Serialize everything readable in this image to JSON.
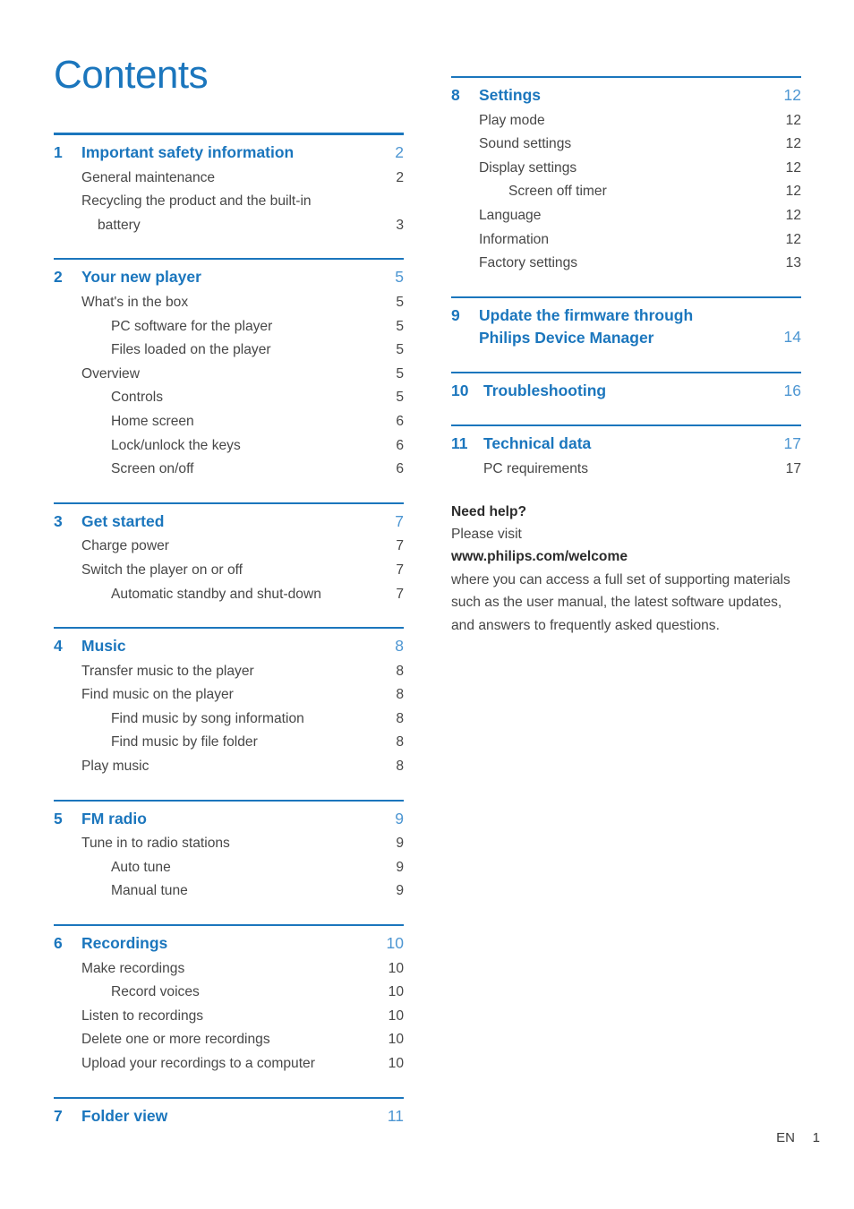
{
  "document": {
    "title": "Contents",
    "accent_color": "#1b76bd",
    "text_color": "#474747"
  },
  "left_column": {
    "chapters": [
      {
        "number": "1",
        "title": "Important safety information",
        "page": "2",
        "rule": "thick",
        "entries": [
          {
            "label": "General maintenance",
            "page": "2",
            "level": 1
          },
          {
            "label": "Recycling the product and the built-in",
            "page": "",
            "level": 1
          },
          {
            "label": "battery",
            "page": "3",
            "level": "1c"
          }
        ]
      },
      {
        "number": "2",
        "title": "Your new player",
        "page": "5",
        "rule": "thin",
        "entries": [
          {
            "label": "What's in the box",
            "page": "5",
            "level": 1
          },
          {
            "label": "PC software for the player",
            "page": "5",
            "level": 2
          },
          {
            "label": "Files loaded on the player",
            "page": "5",
            "level": 2
          },
          {
            "label": "Overview",
            "page": "5",
            "level": 1
          },
          {
            "label": "Controls",
            "page": "5",
            "level": 2
          },
          {
            "label": "Home screen",
            "page": "6",
            "level": 2
          },
          {
            "label": "Lock/unlock the keys",
            "page": "6",
            "level": 2
          },
          {
            "label": "Screen on/off",
            "page": "6",
            "level": 2
          }
        ]
      },
      {
        "number": "3",
        "title": "Get started",
        "page": "7",
        "rule": "thin",
        "entries": [
          {
            "label": "Charge power",
            "page": "7",
            "level": 1
          },
          {
            "label": "Switch the player on or off",
            "page": "7",
            "level": 1
          },
          {
            "label": "Automatic standby and shut-down",
            "page": "7",
            "level": 2
          }
        ]
      },
      {
        "number": "4",
        "title": "Music",
        "page": "8",
        "rule": "thin",
        "entries": [
          {
            "label": "Transfer music to the player",
            "page": "8",
            "level": 1
          },
          {
            "label": "Find music on the player",
            "page": "8",
            "level": 1
          },
          {
            "label": "Find music by song information",
            "page": "8",
            "level": 2
          },
          {
            "label": "Find music by file folder",
            "page": "8",
            "level": 2
          },
          {
            "label": "Play music",
            "page": "8",
            "level": 1
          }
        ]
      },
      {
        "number": "5",
        "title": "FM radio",
        "page": "9",
        "rule": "thin",
        "entries": [
          {
            "label": "Tune in to radio stations",
            "page": "9",
            "level": 1
          },
          {
            "label": "Auto tune",
            "page": "9",
            "level": 2
          },
          {
            "label": "Manual tune",
            "page": "9",
            "level": 2
          }
        ]
      },
      {
        "number": "6",
        "title": "Recordings",
        "page": "10",
        "rule": "thin",
        "entries": [
          {
            "label": "Make recordings",
            "page": "10",
            "level": 1
          },
          {
            "label": "Record voices",
            "page": "10",
            "level": 2
          },
          {
            "label": "Listen to recordings",
            "page": "10",
            "level": 1
          },
          {
            "label": "Delete one or more recordings",
            "page": "10",
            "level": 1
          },
          {
            "label": "Upload your recordings to a computer",
            "page": "10",
            "level": 1
          }
        ]
      },
      {
        "number": "7",
        "title": "Folder view",
        "page": "11",
        "rule": "thin",
        "entries": []
      }
    ]
  },
  "right_column": {
    "chapters": [
      {
        "number": "8",
        "title": "Settings",
        "page": "12",
        "rule": "thin",
        "entries": [
          {
            "label": "Play mode",
            "page": "12",
            "level": 1
          },
          {
            "label": "Sound settings",
            "page": "12",
            "level": 1
          },
          {
            "label": "Display settings",
            "page": "12",
            "level": 1
          },
          {
            "label": "Screen off timer",
            "page": "12",
            "level": 2
          },
          {
            "label": "Language",
            "page": "12",
            "level": 1
          },
          {
            "label": "Information",
            "page": "12",
            "level": 1
          },
          {
            "label": "Factory settings",
            "page": "13",
            "level": 1
          }
        ]
      },
      {
        "number": "9",
        "title": "Update the firmware through Philips Device Manager",
        "title_line1": "Update the firmware through",
        "title_line2": "Philips Device Manager",
        "page": "14",
        "rule": "thin",
        "multiline": true,
        "entries": []
      },
      {
        "number": "10",
        "title": "Troubleshooting",
        "page": "16",
        "rule": "thin",
        "wide_num": true,
        "entries": []
      },
      {
        "number": "11",
        "title": "Technical data",
        "page": "17",
        "rule": "thin",
        "wide_num": true,
        "entries": [
          {
            "label": "PC requirements",
            "page": "17",
            "level": 1
          }
        ]
      }
    ],
    "need_help": {
      "heading": "Need help?",
      "line_visit": "Please visit",
      "url": "www.philips.com/welcome",
      "body": "where you can access a full set of supporting materials such as the user manual, the latest software updates, and answers to frequently asked questions."
    }
  },
  "footer": {
    "language": "EN",
    "page_number": "1"
  }
}
